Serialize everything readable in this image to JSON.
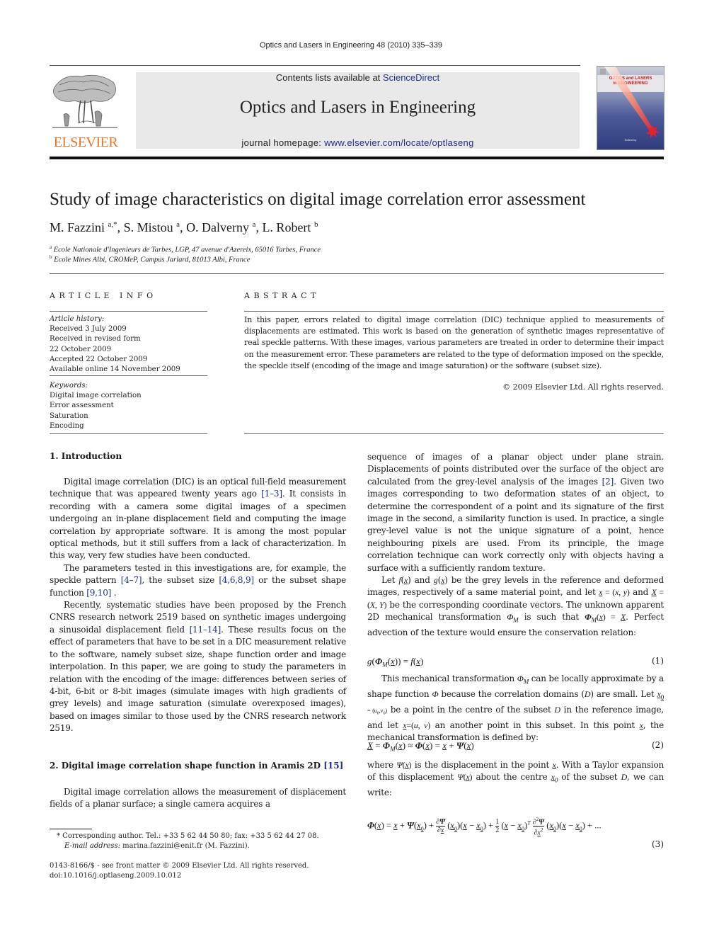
{
  "running_head": "Optics and Lasers in Engineering 48 (2010) 335–339",
  "publisher": {
    "logo_text": "ELSEVIER",
    "logo_color": "#e87722"
  },
  "banner": {
    "contents_prefix": "Contents lists available at ",
    "contents_link": "ScienceDirect",
    "journal_title": "Optics and Lasers in Engineering",
    "homepage_prefix": "journal homepage: ",
    "homepage_link": "www.elsevier.com/locate/optlaseng",
    "link_color": "#1f2f8c"
  },
  "cover": {
    "title_line1": "OPTICS and LASERS",
    "title_line2": "in ENGINEERING",
    "editor_text": "Edited by"
  },
  "article": {
    "title": "Study of image characteristics on digital image correlation error assessment",
    "authors": [
      {
        "name": "M. Fazzini",
        "sup": "a,*"
      },
      {
        "name": "S. Mistou",
        "sup": "a"
      },
      {
        "name": "O. Dalverny",
        "sup": "a"
      },
      {
        "name": "L. Robert",
        "sup": "b"
      }
    ],
    "affiliations": [
      {
        "mark": "a",
        "text": "Ecole Nationale d'Ingenieurs de Tarbes, LGP, 47 avenue d'Azereix, 65016 Tarbes, France"
      },
      {
        "mark": "b",
        "text": "Ecole Mines Albi, CROMeP, Campus Jarlard, 81013 Albi, France"
      }
    ]
  },
  "article_info": {
    "heading": "ARTICLE INFO",
    "history_label": "Article history:",
    "history": [
      "Received 3 July 2009",
      "Received in revised form",
      "22 October 2009",
      "Accepted 22 October 2009",
      "Available online 14 November 2009"
    ],
    "keywords_label": "Keywords:",
    "keywords": [
      "Digital image correlation",
      "Error assessment",
      "Saturation",
      "Encoding"
    ]
  },
  "abstract": {
    "heading": "ABSTRACT",
    "text": "In this paper, errors related to digital image correlation (DIC) technique applied to measurements of displacements are estimated. This work is based on the generation of synthetic images representative of real speckle patterns. With these images, various parameters are treated in order to determine their impact on the measurement error. These parameters are related to the type of deformation imposed on the speckle, the speckle itself (encoding of the image and image saturation) or the software (subset size).",
    "copyright": "© 2009 Elsevier Ltd. All rights reserved."
  },
  "section1": {
    "heading": "1.  Introduction",
    "p1_a": "Digital image correlation (DIC) is an optical full-field measurement technique that was appeared twenty years ago ",
    "p1_ref": "[1–3]",
    "p1_b": ". It consists in recording with a camera some digital images of a specimen undergoing an in-plane displacement field and computing the image correlation by appropriate software. It is among the most popular optical methods, but it still suffers from a lack of characterization. In this way, very few studies have been conducted.",
    "p2_a": "The parameters tested in this investigations are, for example, the speckle pattern ",
    "p2_ref1": "[4–7]",
    "p2_b": ", the subset size ",
    "p2_ref2": "[4,6,8,9]",
    "p2_c": " or the subset shape function ",
    "p2_ref3": "[9,10]",
    "p2_d": " .",
    "p3_a": "Recently, systematic studies have been proposed by the French CNRS research network 2519 based on synthetic images undergoing a sinusoidal displacement field ",
    "p3_ref": "[11–14]",
    "p3_b": ". These results focus on the effect of parameters that have to be set in a DIC measurement relative to the software, namely subset size, shape function order and image interpolation. In this paper, we are going to study the parameters in relation with the encoding of the image: differences between series of 4-bit, 6-bit or 8-bit images (simulate images with high gradients of grey levels) and image saturation (simulate overexposed images), based on images similar to those used by the CNRS research network 2519."
  },
  "section2": {
    "heading": "2.  Digital image correlation shape function in Aramis 2D ",
    "heading_ref": "[15]",
    "p1": "Digital image correlation allows the measurement of displacement fields of a planar surface; a single camera acquires a",
    "right_p1_a": "sequence of images of a planar object under plane strain. Displacements of points distributed over the surface of the object are calculated from the grey-level analysis of the images ",
    "right_p1_ref": "[2]",
    "right_p1_b": ". Given two images corresponding to two deformation states of an object, to determine the correspondent of a point and its signature of the first image in the second, a similarity function is used. In practice, a single grey-level value is not the unique signature of a point, hence neighbouring pixels are used. From its principle, the image correlation technique can work correctly only with objects having a surface with a sufficiently random texture.",
    "right_p2_let": "Let ",
    "right_p2_and": " and ",
    "right_p2_a": " be the grey levels in the reference and deformed images, respectively of a same material point, and let ",
    "right_p2_b": " and ",
    "right_p2_c": " be the corresponding coordinate vectors. The unknown apparent 2D mechanical transformation ",
    "right_p2_d": " is such that ",
    "right_p2_e": ". Perfect advection of the texture would ensure the conservation relation:",
    "right_p3_a": "This mechanical transformation ",
    "right_p3_b": " can be locally approximate by a shape function ",
    "right_p3_c": " because the correlation domains (",
    "right_p3_d": ") are small. Let ",
    "right_p3_e": " be a point in the centre of the subset ",
    "right_p3_f": " in the reference image, and let ",
    "right_p3_g": " an another point in this subset. In this point ",
    "right_p3_h": ", the mechanical transformation is defined by:",
    "right_p4_a": "where ",
    "right_p4_b": " is the displacement in the point ",
    "right_p4_c": ". With a Taylor expansion of this displacement ",
    "right_p4_d": " about the centre ",
    "right_p4_e": " of the subset ",
    "right_p4_f": ", we can write:"
  },
  "equations": [
    {
      "number": "(1)"
    },
    {
      "number": "(2)"
    },
    {
      "number": "(3)"
    }
  ],
  "footnotes": {
    "corresponding": "* Corresponding author. Tel.: +33 5 62 44 50 80; fax: +33 5 62 44 27 08.",
    "email_label": "E-mail address:",
    "email": " marina.fazzini@enit.fr (M. Fazzini).",
    "front_matter": "0143-8166/$ - see front matter © 2009 Elsevier Ltd. All rights reserved.",
    "doi": "doi:10.1016/j.optlaseng.2009.10.012"
  }
}
